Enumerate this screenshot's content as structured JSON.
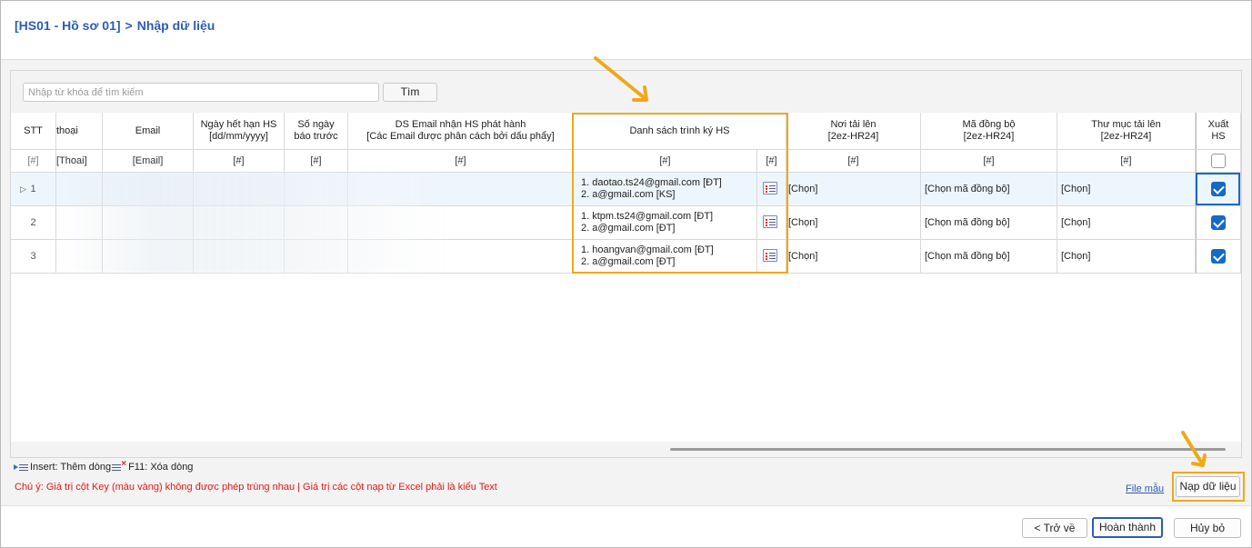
{
  "header": {
    "breadcrumb_code": "[HS01 - Hồ sơ 01]",
    "breadcrumb_sep": ">",
    "breadcrumb_page": "Nhập dữ liệu"
  },
  "search": {
    "placeholder": "Nhập từ khóa để tìm kiếm",
    "value": "",
    "button_label": "Tìm"
  },
  "grid": {
    "columns": [
      {
        "key": "stt",
        "label": "STT",
        "filter": "[#]"
      },
      {
        "key": "phone",
        "label": "thoại",
        "filter": "[Thoai]"
      },
      {
        "key": "email",
        "label": "Email",
        "filter": "[Email]"
      },
      {
        "key": "expiry",
        "label": "Ngày hết hạn HS\n[dd/mm/yyyy]",
        "filter": "[#]"
      },
      {
        "key": "notice",
        "label": "Số ngày\nbáo trước",
        "filter": "[#]"
      },
      {
        "key": "ds_email",
        "label": "DS Email nhận HS phát hành\n[Các Email được phân cách bởi dấu phẩy]",
        "filter": "[#]"
      },
      {
        "key": "signers",
        "label": "Danh sách trình ký HS",
        "filter": "[#]",
        "filter2": "[#]"
      },
      {
        "key": "upload_place",
        "label": "Nơi tải lên\n[2ez-HR24]",
        "filter": "[#]"
      },
      {
        "key": "sync_code",
        "label": "Mã đồng bộ\n[2ez-HR24]",
        "filter": "[#]"
      },
      {
        "key": "upload_folder",
        "label": "Thư mục tải lên\n[2ez-HR24]",
        "filter": "[#]"
      },
      {
        "key": "export",
        "label": "Xuất\nHS"
      }
    ],
    "rows": [
      {
        "stt": "1",
        "signers": [
          "1. daotao.ts24@gmail.com [ĐT]",
          "2. a@gmail.com [KS]"
        ],
        "upload_place": "[Chọn]",
        "sync_code": "[Chọn mã đồng bộ]",
        "upload_folder": "[Chọn]",
        "export": true
      },
      {
        "stt": "2",
        "signers": [
          "1. ktpm.ts24@gmail.com [ĐT]",
          "2. a@gmail.com [ĐT]"
        ],
        "upload_place": "[Chọn]",
        "sync_code": "[Chọn mã đồng bộ]",
        "upload_folder": "[Chọn]",
        "export": true
      },
      {
        "stt": "3",
        "signers": [
          "1. hoangvan@gmail.com [ĐT]",
          "2. a@gmail.com [ĐT]"
        ],
        "upload_place": "[Chọn]",
        "sync_code": "[Chọn mã đồng bộ]",
        "upload_folder": "[Chọn]",
        "export": true
      }
    ],
    "export_header_checked": false
  },
  "hints": {
    "insert": "Insert: Thêm dòng",
    "delete": "F11: Xóa dòng"
  },
  "note": "Chú ý: Giá trị cột Key (màu vàng) không được phép trùng nhau | Giá trị các cột nạp từ Excel phải là kiểu Text",
  "file_sample_link": "File mẫu",
  "load_button": "Nạp dữ liệu",
  "footer": {
    "back": "< Trở về",
    "finish": "Hoàn thành",
    "cancel": "Hủy bỏ"
  },
  "colors": {
    "accent": "#2b5db3",
    "highlight": "#f0a81a",
    "checkbox": "#1569c7",
    "warning": "#e01919"
  }
}
